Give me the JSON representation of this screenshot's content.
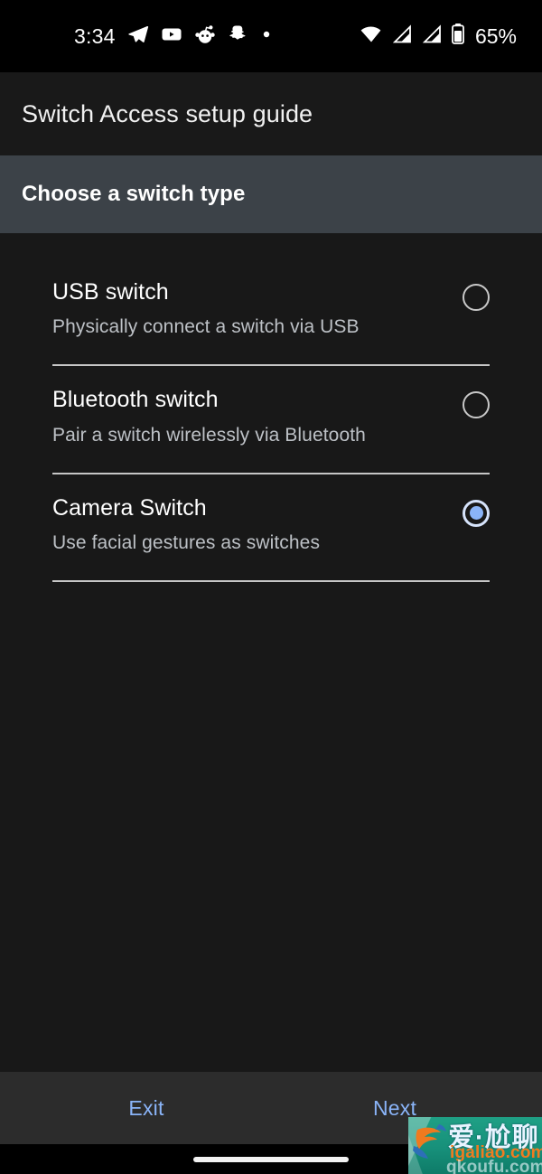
{
  "status_bar": {
    "time": "3:34",
    "battery_percent": "65%",
    "notification_icons": [
      "telegram-icon",
      "youtube-icon",
      "reddit-icon",
      "snapchat-icon",
      "dot-icon"
    ],
    "system_icons": [
      "wifi-icon",
      "signal-bars-icon",
      "signal-bars-2-icon",
      "battery-icon"
    ]
  },
  "header": {
    "title": "Switch Access setup guide"
  },
  "section": {
    "title": "Choose a switch type"
  },
  "options": [
    {
      "title": "USB switch",
      "subtitle": "Physically connect a switch via USB",
      "selected": false
    },
    {
      "title": "Bluetooth switch",
      "subtitle": "Pair a switch wirelessly via Bluetooth",
      "selected": false
    },
    {
      "title": "Camera Switch",
      "subtitle": "Use facial gestures as switches",
      "selected": true
    }
  ],
  "action_bar": {
    "exit_label": "Exit",
    "next_label": "Next"
  },
  "watermark": {
    "cn_text": "爱·尬聊",
    "domain": "igaliao.com",
    "domain2": "qkoufu.com-"
  },
  "colors": {
    "accent": "#8ab4f8",
    "background": "#181818",
    "title_bar": "#191919",
    "section_band": "#3c4248",
    "action_bar": "#2c2c2c",
    "divider": "#c6c6c6",
    "subtitle_text": "#bdc1c6"
  }
}
